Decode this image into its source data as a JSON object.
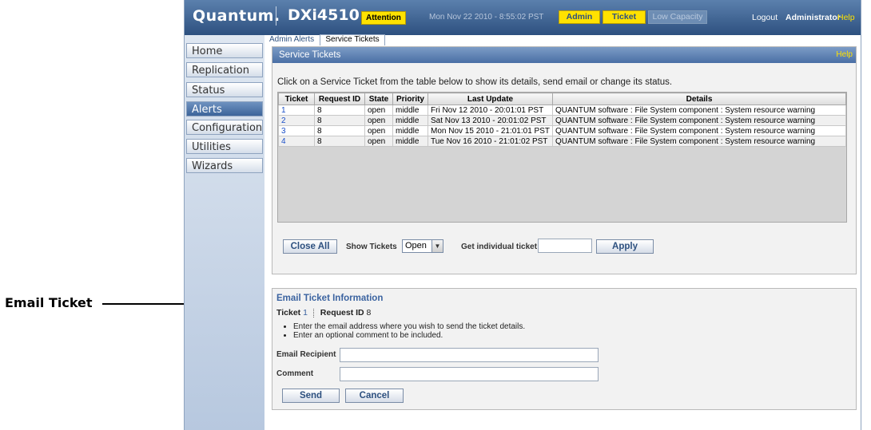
{
  "callout": {
    "label": "Email Ticket"
  },
  "header": {
    "logo": "Quantum.",
    "model": "DXi4510",
    "attention": "Attention",
    "datetime": "Mon Nov 22 2010 - 8:55:02 PST",
    "buttons": {
      "admin": "Admin",
      "ticket": "Ticket",
      "low_capacity": "Low Capacity"
    },
    "logout": "Logout",
    "user": "Administrator",
    "help": "Help"
  },
  "sidebar": {
    "items": [
      {
        "label": "Home"
      },
      {
        "label": "Replication"
      },
      {
        "label": "Status"
      },
      {
        "label": "Alerts",
        "active": true
      },
      {
        "label": "Configuration"
      },
      {
        "label": "Utilities"
      },
      {
        "label": "Wizards"
      }
    ]
  },
  "tabs": {
    "admin_alerts": "Admin Alerts",
    "service_tickets": "Service Tickets"
  },
  "tickets_panel": {
    "title": "Service Tickets",
    "help": "Help",
    "instruction": "Click on a Service Ticket from the table below to show its details, send email or change its status.",
    "columns": [
      "Ticket",
      "Request ID",
      "State",
      "Priority",
      "Last Update",
      "Details"
    ],
    "rows": [
      [
        "1",
        "8",
        "open",
        "middle",
        "Fri Nov 12 2010 - 20:01:01 PST",
        "QUANTUM software : File System component : System resource warning"
      ],
      [
        "2",
        "8",
        "open",
        "middle",
        "Sat Nov 13 2010 - 20:01:02 PST",
        "QUANTUM software : File System component : System resource warning"
      ],
      [
        "3",
        "8",
        "open",
        "middle",
        "Mon Nov 15 2010 - 21:01:01 PST",
        "QUANTUM software : File System component : System resource warning"
      ],
      [
        "4",
        "8",
        "open",
        "middle",
        "Tue Nov 16 2010 - 21:01:02 PST",
        "QUANTUM software : File System component : System resource warning"
      ]
    ],
    "close_all": "Close All",
    "show_tickets_label": "Show Tickets",
    "show_tickets_value": "Open",
    "get_ticket_label": "Get individual ticket",
    "get_ticket_value": "",
    "apply": "Apply"
  },
  "email_panel": {
    "title": "Email Ticket Information",
    "ticket_label": "Ticket",
    "ticket_value": "1",
    "request_label": "Request ID",
    "request_value": "8",
    "bullets": [
      "Enter the email address where you wish to send the ticket details.",
      "Enter an optional comment to be included."
    ],
    "recipient_label": "Email Recipient",
    "recipient_value": "",
    "comment_label": "Comment",
    "comment_value": "",
    "send": "Send",
    "cancel": "Cancel"
  },
  "colors": {
    "header": "#2d507f",
    "accent_yellow": "#ffe200",
    "link": "#1a4fc8"
  },
  "icons": {
    "select_arrow": "chevron-down-icon"
  }
}
